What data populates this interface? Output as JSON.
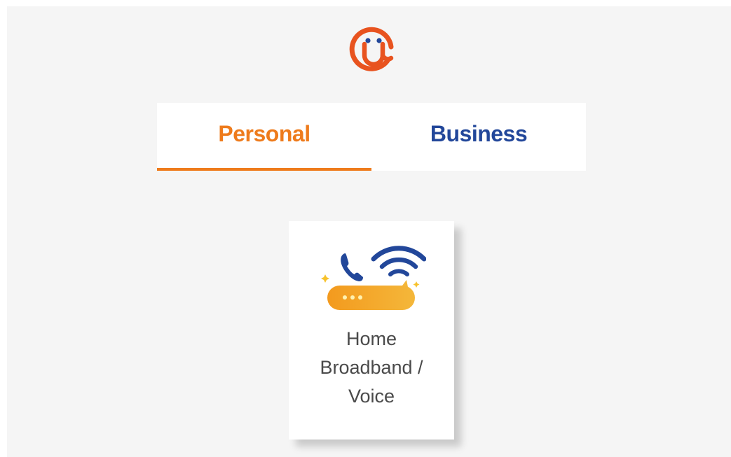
{
  "logo": {
    "icon": "smiling-at-sign-logo-icon",
    "color": "#e8531f",
    "eye_color": "#22479a"
  },
  "tabs": [
    {
      "label": "Personal",
      "active": true,
      "color": "#ee7b1c"
    },
    {
      "label": "Business",
      "active": false,
      "color": "#22479a"
    }
  ],
  "service_card": {
    "icon": "broadband-voice-icon",
    "label_lines": [
      "Home",
      "Broadband /",
      "Voice"
    ]
  }
}
